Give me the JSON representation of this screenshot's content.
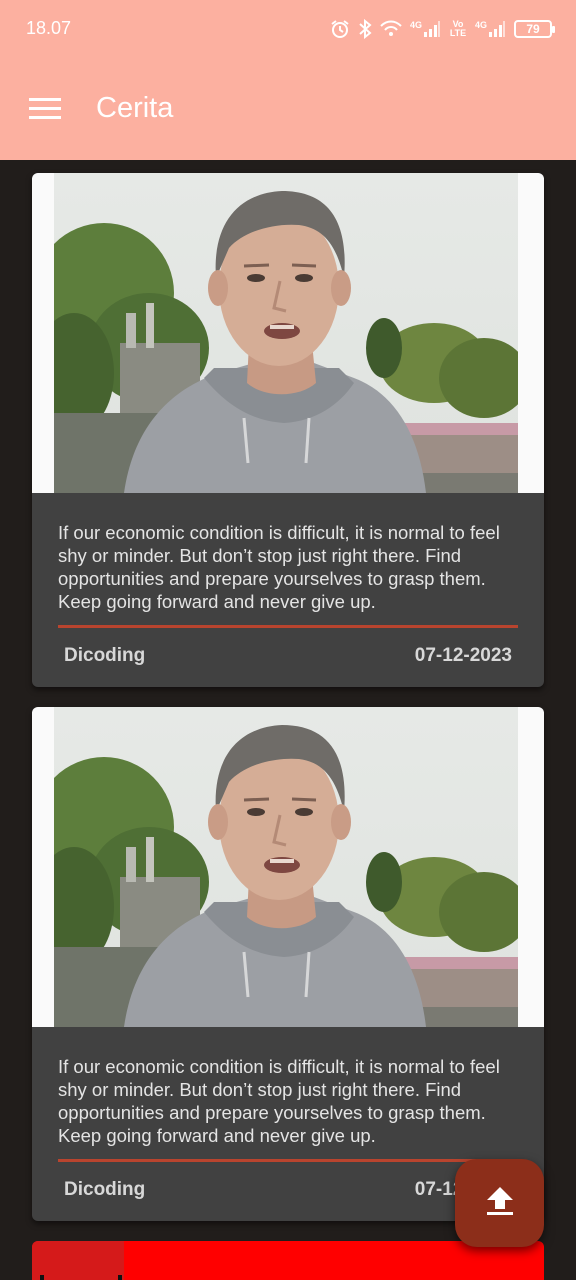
{
  "status_bar": {
    "time": "18.07",
    "battery": "79",
    "icons": [
      "alarm-icon",
      "bluetooth-icon",
      "wifi-icon",
      "signal-4g-icon",
      "volte-icon",
      "signal-4g-icon",
      "battery-icon"
    ],
    "network_labels": {
      "first": "4G",
      "volte": "Vo LTE",
      "second": "4G"
    }
  },
  "app_bar": {
    "title": "Cerita",
    "menu_icon": "hamburger-menu-icon",
    "color": "#fcb0a0"
  },
  "stories": [
    {
      "description": "If our economic condition is difficult, it is normal to feel shy or minder. But don’t stop just right there. Find opportunities and prepare yourselves to grasp them. Keep going forward and never give up.",
      "author": "Dicoding",
      "date": "07-12-2023"
    },
    {
      "description": "If our economic condition is difficult, it is normal to feel shy or minder. But don’t stop just right there. Find opportunities and prepare yourselves to grasp them. Keep going forward and never give up.",
      "author": "Dicoding",
      "date": "07-12-2023"
    }
  ],
  "fab": {
    "icon": "upload-icon",
    "color": "#8c2e1a"
  },
  "colors": {
    "background": "#211d1b",
    "card": "#414141",
    "divider": "#b9442e",
    "text": "#e4e4e4"
  }
}
